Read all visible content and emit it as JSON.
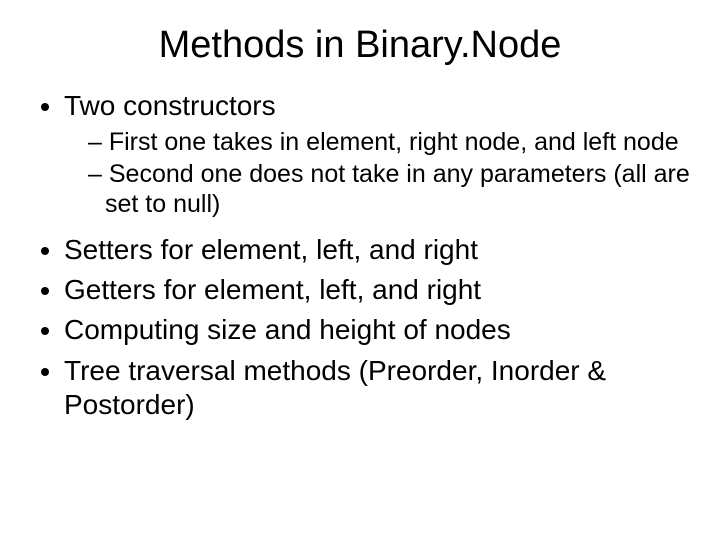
{
  "title": "Methods in Binary.Node",
  "bullets": {
    "b0": "Two constructors",
    "b0_sub0": "First one takes in element, right node, and left node",
    "b0_sub1": "Second one does not take in any parameters (all are set to null)",
    "b1": "Setters for element, left, and right",
    "b2": "Getters for element, left, and right",
    "b3": "Computing size and height of nodes",
    "b4": "Tree traversal methods (Preorder, Inorder & Postorder)"
  }
}
